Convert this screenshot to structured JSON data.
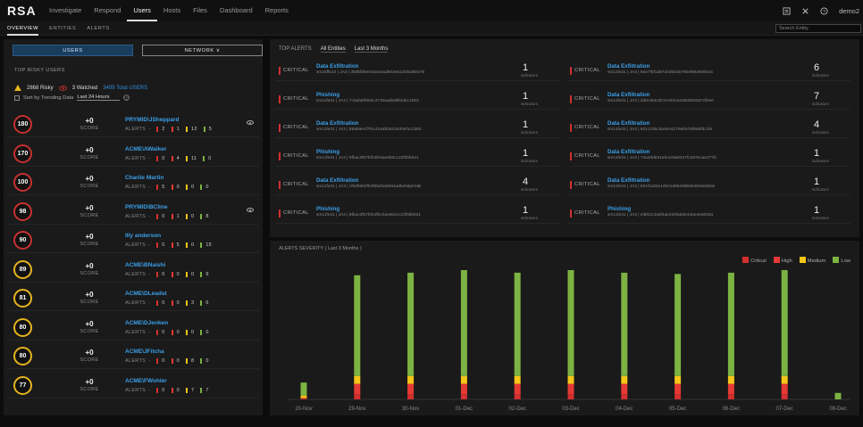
{
  "header": {
    "logo": "RSA",
    "nav": [
      "Investigate",
      "Respond",
      "Users",
      "Hosts",
      "Files",
      "Dashboard",
      "Reports"
    ],
    "active_nav": "Users",
    "user": "demo2"
  },
  "subnav": {
    "tabs": [
      "OVERVIEW",
      "ENTITIES",
      "ALERTS"
    ],
    "search_placeholder": "Search Entity"
  },
  "left": {
    "buttons": {
      "users": "USERS",
      "network": "NETWORK ∨"
    },
    "title": "TOP RISKY USERS",
    "risky": "2868 Risky",
    "watched": "3 Watched",
    "total": "3409 Total USERS",
    "sort_label": "Sort by Trending Data",
    "sort_value": "Last 24 Hours",
    "score_label": "SCORE",
    "alerts_label": "ALERTS",
    "users": [
      {
        "score": "180",
        "delta": "+0",
        "name": "PRYMID\\JSheppard",
        "alerts": [
          "2",
          "1",
          "12",
          "5"
        ],
        "ring": "#c83030",
        "watched": true
      },
      {
        "score": "170",
        "delta": "+0",
        "name": "ACME\\AWalker",
        "alerts": [
          "0",
          "4",
          "11",
          "0"
        ],
        "ring": "#c83030",
        "watched": false
      },
      {
        "score": "100",
        "delta": "+0",
        "name": "Charlie Martin",
        "alerts": [
          "5",
          "0",
          "0",
          "0"
        ],
        "ring": "#c83030",
        "watched": false
      },
      {
        "score": "98",
        "delta": "+0",
        "name": "PRYMID\\BCline",
        "alerts": [
          "0",
          "1",
          "0",
          "8"
        ],
        "ring": "#c83030",
        "watched": true
      },
      {
        "score": "90",
        "delta": "+0",
        "name": "Illy anderson",
        "alerts": [
          "0",
          "5",
          "0",
          "15"
        ],
        "ring": "#c83030",
        "watched": false
      },
      {
        "score": "89",
        "delta": "+0",
        "name": "ACME\\BNaishi",
        "alerts": [
          "0",
          "0",
          "0",
          "9"
        ],
        "ring": "#e6b420",
        "watched": false
      },
      {
        "score": "81",
        "delta": "+0",
        "name": "ACME\\DLeadst",
        "alerts": [
          "0",
          "0",
          "3",
          "6"
        ],
        "ring": "#e6b420",
        "watched": false
      },
      {
        "score": "80",
        "delta": "+0",
        "name": "ACME\\DJenken",
        "alerts": [
          "0",
          "0",
          "0",
          "0"
        ],
        "ring": "#e6b420",
        "watched": false
      },
      {
        "score": "80",
        "delta": "+0",
        "name": "ACME\\JFitcha",
        "alerts": [
          "0",
          "0",
          "8",
          "0"
        ],
        "ring": "#e6b420",
        "watched": false
      },
      {
        "score": "77",
        "delta": "+0",
        "name": "ACME\\FWohler",
        "alerts": [
          "0",
          "0",
          "7",
          "7"
        ],
        "ring": "#e6b420",
        "watched": false
      }
    ]
  },
  "top_alerts": {
    "title": "TOP ALERTS",
    "filter": "All Entities",
    "range": "Last 3 Months",
    "indicators_label": "indicators",
    "cards": [
      {
        "sev": "CRITICAL",
        "title": "Data Exfiltration",
        "sub": "sm22ffe22  |  JA3  |  d93bfd0e010a44ad603e612f45d5b578",
        "num": "1"
      },
      {
        "sev": "CRITICAL",
        "title": "Data Exfiltration",
        "sub": "sm11fe31  |  JA3  |  50e7f0f1d87343b0a579bef9648000c5",
        "num": "6"
      },
      {
        "sev": "CRITICAL",
        "title": "Phishing",
        "sub": "sm11fe31  |  JA3  |  7c0afabf9e5c4730aad5d8f44bc1b53",
        "num": "1"
      },
      {
        "sev": "CRITICAL",
        "title": "Data Exfiltration",
        "sub": "sm11fe31  |  JA3  |  d2fe493c2b7e434ca2560600587df2e0",
        "num": "7"
      },
      {
        "sev": "CRITICAL",
        "title": "Data Exfiltration",
        "sub": "sm11fe31  |  JA3  |  55ab9ecf7fe142a4bb523440ef1c2362",
        "num": "1"
      },
      {
        "sev": "CRITICAL",
        "title": "Data Exfiltration",
        "sub": "sm11fe31  |  JA3  |  601c235cda0e44179eb575f8ebfdc1fe",
        "num": "4"
      },
      {
        "sev": "CRITICAL",
        "title": "Phishing",
        "sub": "sm11fe31  |  JA3  |  9fbac3f67bf24fe0ae663cc23f0bb621",
        "num": "1"
      },
      {
        "sev": "CRITICAL",
        "title": "Data Exfiltration",
        "sub": "sm11fe31  |  JA3  |  73a3dd831afe428a8347fc2970cae277b",
        "num": "1"
      },
      {
        "sev": "CRITICAL",
        "title": "Data Exfiltration",
        "sub": "sm11fe31  |  JA3  |  cf9d0d62f54fd5d3a0084ad5eb8jertaB",
        "num": "4"
      },
      {
        "sev": "CRITICAL",
        "title": "Data Exfiltration",
        "sub": "sm11fe31  |  JA3  |  b91f1182e1d54198be58b89463a5d63e",
        "num": "1"
      },
      {
        "sev": "CRITICAL",
        "title": "Phishing",
        "sub": "sm11fe31  |  JA3  |  9fbac3f67bf24fbc0ae663cc23f0bb621",
        "num": "1"
      },
      {
        "sev": "CRITICAL",
        "title": "Phishing",
        "sub": "sm11fe31  |  JA3  |  efd0214a6f4ae420fa6d244ae4e6034a",
        "num": "1"
      }
    ]
  },
  "severity": {
    "title": "ALERTS SEVERITY ( Last 3 Months )",
    "legend": [
      {
        "name": "Critical",
        "color": "#d32f2f"
      },
      {
        "name": "High",
        "color": "#e53935"
      },
      {
        "name": "Medium",
        "color": "#f5c518"
      },
      {
        "name": "Low",
        "color": "#7cb342"
      }
    ]
  },
  "chart_data": {
    "type": "bar",
    "stacked": true,
    "title": "ALERTS SEVERITY ( Last 3 Months )",
    "categories": [
      "20-Nov",
      "29-Nov",
      "30-Nov",
      "01-Dec",
      "02-Dec",
      "03-Dec",
      "04-Dec",
      "05-Dec",
      "06-Dec",
      "07-Dec",
      "08-Dec"
    ],
    "series": [
      {
        "name": "Critical",
        "color": "#d32f2f",
        "values": [
          1,
          4,
          4,
          4,
          4,
          4,
          4,
          4,
          4,
          4,
          0
        ]
      },
      {
        "name": "High",
        "color": "#e53935",
        "values": [
          0,
          8,
          8,
          8,
          8,
          8,
          8,
          8,
          8,
          8,
          0
        ]
      },
      {
        "name": "Medium",
        "color": "#f5c518",
        "values": [
          2,
          6,
          6,
          6,
          6,
          6,
          6,
          6,
          6,
          6,
          0
        ]
      },
      {
        "name": "Low",
        "color": "#7cb342",
        "values": [
          10,
          78,
          80,
          82,
          80,
          82,
          80,
          79,
          80,
          82,
          5
        ]
      }
    ],
    "legend_position": "top-right",
    "grid": false
  }
}
